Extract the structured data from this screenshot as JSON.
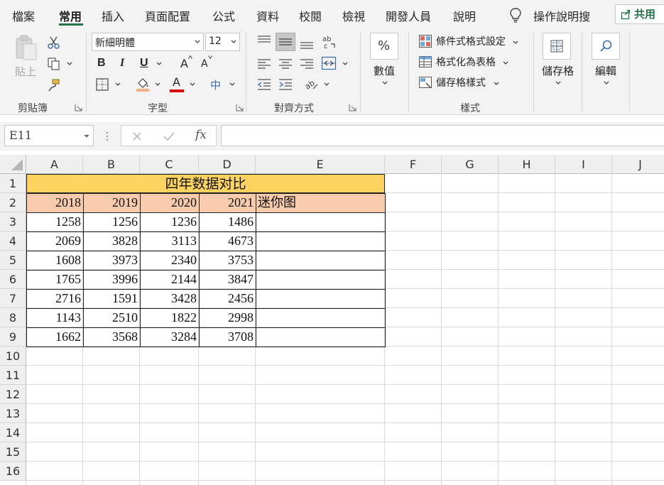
{
  "menu": {
    "tabs": [
      "檔案",
      "常用",
      "插入",
      "頁面配置",
      "公式",
      "資料",
      "校閱",
      "檢視",
      "開發人員",
      "說明"
    ],
    "active_tab": "常用",
    "tell_me": "操作說明搜",
    "share": "共用"
  },
  "ribbon": {
    "clipboard": {
      "paste": "貼上",
      "label": "剪貼簿"
    },
    "font": {
      "name": "新細明體",
      "size": "12",
      "bold": "B",
      "italic": "I",
      "underline": "U",
      "grow": "A",
      "shrink": "A",
      "font_color": "A",
      "phonetic": "中",
      "label": "字型"
    },
    "alignment": {
      "label": "對齊方式"
    },
    "number": {
      "symbol": "%",
      "label": "數值"
    },
    "styles": {
      "conditional": "條件式格式設定",
      "table": "格式化為表格",
      "cell_styles": "儲存格樣式",
      "label": "樣式"
    },
    "cells": {
      "label": "儲存格"
    },
    "editing": {
      "label": "編輯"
    }
  },
  "formula_bar": {
    "name_box": "E11",
    "fx": "fx",
    "formula": ""
  },
  "sheet": {
    "columns": [
      "A",
      "B",
      "C",
      "D",
      "E",
      "F",
      "G",
      "H",
      "I",
      "J"
    ],
    "rows": [
      "1",
      "2",
      "3",
      "4",
      "5",
      "6",
      "7",
      "8",
      "9",
      "10",
      "11",
      "12",
      "13",
      "14",
      "15",
      "16"
    ],
    "title": "四年数据对比",
    "headers": [
      "2018",
      "2019",
      "2020",
      "2021",
      "迷你图"
    ],
    "data": [
      [
        "1258",
        "1256",
        "1236",
        "1486"
      ],
      [
        "2069",
        "3828",
        "3113",
        "4673"
      ],
      [
        "1608",
        "3973",
        "2340",
        "3753"
      ],
      [
        "1765",
        "3996",
        "2144",
        "3847"
      ],
      [
        "2716",
        "1591",
        "3428",
        "2456"
      ],
      [
        "1143",
        "2510",
        "1822",
        "2998"
      ],
      [
        "1662",
        "3568",
        "3284",
        "3708"
      ]
    ]
  },
  "colors": {
    "accent": "#217346",
    "title_fill": "#fcd35f",
    "header_fill": "#f8cbad",
    "font_color_bar": "#e00000",
    "fill_color_bar": "#f4b183"
  }
}
